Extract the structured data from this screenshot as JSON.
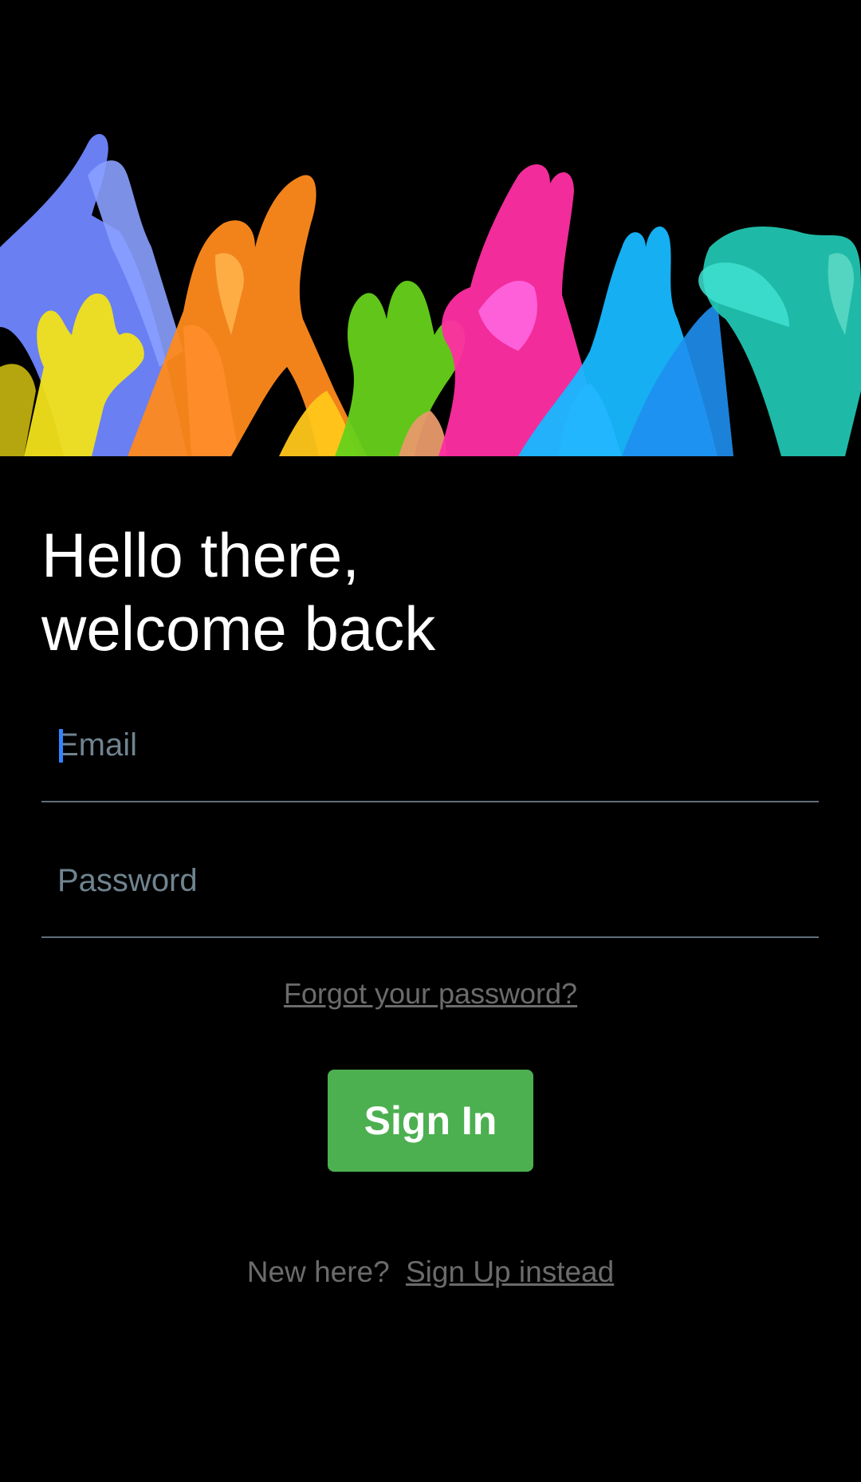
{
  "hero": {
    "image": "hands-raised-illustration",
    "colors": [
      "#6f86ff",
      "#f2e21a",
      "#ff8a1c",
      "#eeb2ff",
      "#66d11a",
      "#ff2ea3",
      "#16b8ff",
      "#21c4b0"
    ]
  },
  "greeting": {
    "line1": "Hello there,",
    "line2": "welcome back"
  },
  "form": {
    "email_placeholder": "Email",
    "email_value": "",
    "password_placeholder": "Password",
    "password_value": ""
  },
  "links": {
    "forgot": "Forgot your password?"
  },
  "actions": {
    "sign_in": "Sign In"
  },
  "signup": {
    "prompt": "New here?",
    "link": "Sign Up instead"
  },
  "colors": {
    "background": "#000000",
    "primary_button": "#4caf50",
    "field_underline": "#5f6f7a",
    "placeholder": "#6f8490",
    "caret": "#2f86ff",
    "muted_text": "#6b6b6b"
  }
}
